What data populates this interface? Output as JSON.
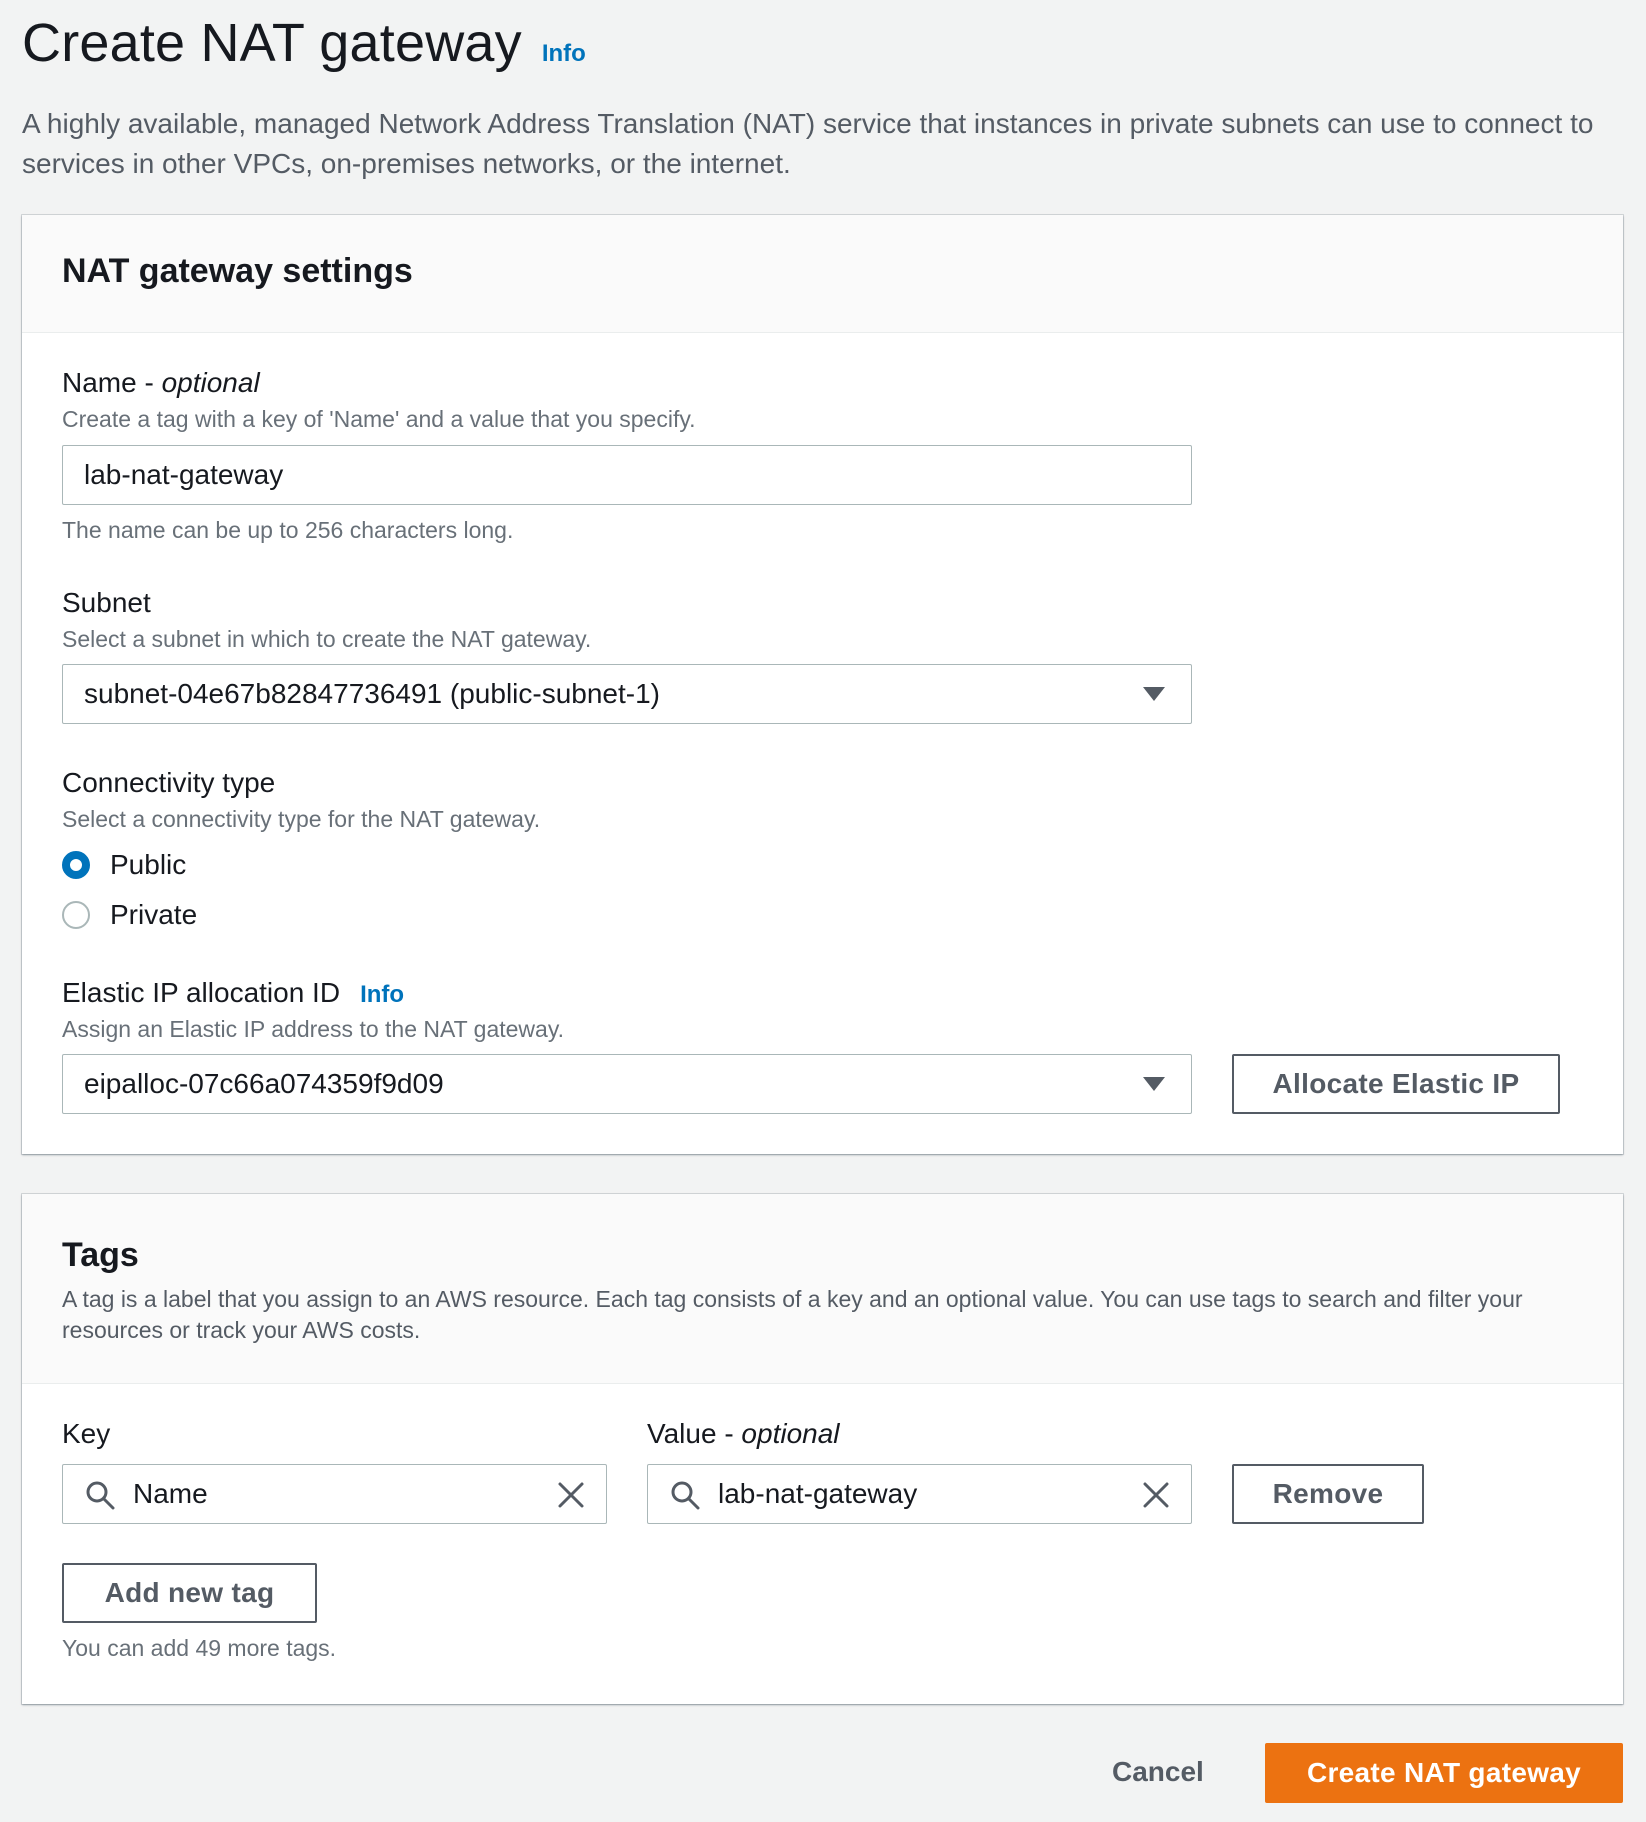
{
  "header": {
    "title": "Create NAT gateway",
    "info": "Info",
    "description": "A highly available, managed Network Address Translation (NAT) service that instances in private subnets can use to connect to services in other VPCs, on-premises networks, or the internet."
  },
  "settings": {
    "title": "NAT gateway settings",
    "name": {
      "label": "Name - ",
      "label_optional": "optional",
      "description": "Create a tag with a key of 'Name' and a value that you specify.",
      "value": "lab-nat-gateway",
      "constraint": "The name can be up to 256 characters long."
    },
    "subnet": {
      "label": "Subnet",
      "description": "Select a subnet in which to create the NAT gateway.",
      "value": "subnet-04e67b82847736491 (public-subnet-1)"
    },
    "connectivity": {
      "label": "Connectivity type",
      "description": "Select a connectivity type for the NAT gateway.",
      "options": [
        "Public",
        "Private"
      ],
      "selected": "Public"
    },
    "eip": {
      "label": "Elastic IP allocation ID",
      "info": "Info",
      "description": "Assign an Elastic IP address to the NAT gateway.",
      "value": "eipalloc-07c66a074359f9d09",
      "allocate_button": "Allocate Elastic IP"
    }
  },
  "tags": {
    "title": "Tags",
    "description": "A tag is a label that you assign to an AWS resource. Each tag consists of a key and an optional value. You can use tags to search and filter your resources or track your AWS costs.",
    "key_label": "Key",
    "value_label": "Value - ",
    "value_label_optional": "optional",
    "rows": [
      {
        "key": "Name",
        "value": "lab-nat-gateway"
      }
    ],
    "remove_button": "Remove",
    "add_button": "Add new tag",
    "remaining": "You can add 49 more tags."
  },
  "footer": {
    "cancel": "Cancel",
    "create": "Create NAT gateway"
  },
  "colors": {
    "primary": "#ec7211",
    "link": "#0073bb",
    "background": "#f2f3f3"
  }
}
